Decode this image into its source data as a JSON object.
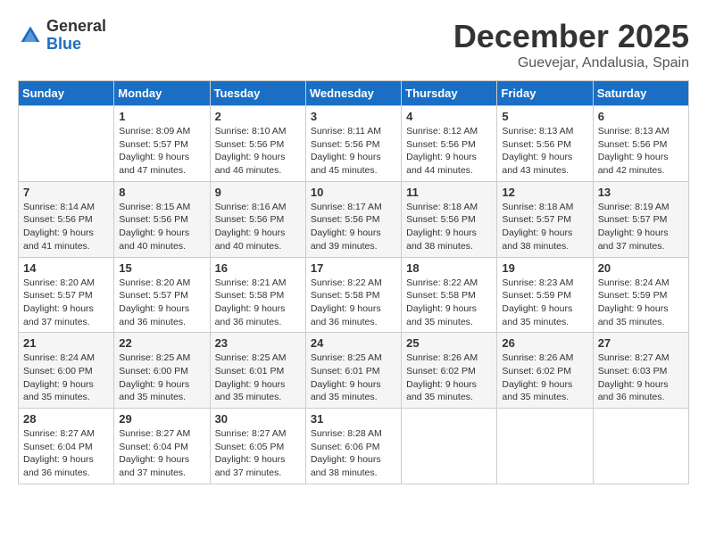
{
  "logo": {
    "general": "General",
    "blue": "Blue"
  },
  "header": {
    "month": "December 2025",
    "location": "Guevejar, Andalusia, Spain"
  },
  "columns": [
    "Sunday",
    "Monday",
    "Tuesday",
    "Wednesday",
    "Thursday",
    "Friday",
    "Saturday"
  ],
  "weeks": [
    [
      {
        "day": "",
        "empty": true
      },
      {
        "day": "1",
        "sunrise": "Sunrise: 8:09 AM",
        "sunset": "Sunset: 5:57 PM",
        "daylight": "Daylight: 9 hours and 47 minutes."
      },
      {
        "day": "2",
        "sunrise": "Sunrise: 8:10 AM",
        "sunset": "Sunset: 5:56 PM",
        "daylight": "Daylight: 9 hours and 46 minutes."
      },
      {
        "day": "3",
        "sunrise": "Sunrise: 8:11 AM",
        "sunset": "Sunset: 5:56 PM",
        "daylight": "Daylight: 9 hours and 45 minutes."
      },
      {
        "day": "4",
        "sunrise": "Sunrise: 8:12 AM",
        "sunset": "Sunset: 5:56 PM",
        "daylight": "Daylight: 9 hours and 44 minutes."
      },
      {
        "day": "5",
        "sunrise": "Sunrise: 8:13 AM",
        "sunset": "Sunset: 5:56 PM",
        "daylight": "Daylight: 9 hours and 43 minutes."
      },
      {
        "day": "6",
        "sunrise": "Sunrise: 8:13 AM",
        "sunset": "Sunset: 5:56 PM",
        "daylight": "Daylight: 9 hours and 42 minutes."
      }
    ],
    [
      {
        "day": "7",
        "sunrise": "Sunrise: 8:14 AM",
        "sunset": "Sunset: 5:56 PM",
        "daylight": "Daylight: 9 hours and 41 minutes."
      },
      {
        "day": "8",
        "sunrise": "Sunrise: 8:15 AM",
        "sunset": "Sunset: 5:56 PM",
        "daylight": "Daylight: 9 hours and 40 minutes."
      },
      {
        "day": "9",
        "sunrise": "Sunrise: 8:16 AM",
        "sunset": "Sunset: 5:56 PM",
        "daylight": "Daylight: 9 hours and 40 minutes."
      },
      {
        "day": "10",
        "sunrise": "Sunrise: 8:17 AM",
        "sunset": "Sunset: 5:56 PM",
        "daylight": "Daylight: 9 hours and 39 minutes."
      },
      {
        "day": "11",
        "sunrise": "Sunrise: 8:18 AM",
        "sunset": "Sunset: 5:56 PM",
        "daylight": "Daylight: 9 hours and 38 minutes."
      },
      {
        "day": "12",
        "sunrise": "Sunrise: 8:18 AM",
        "sunset": "Sunset: 5:57 PM",
        "daylight": "Daylight: 9 hours and 38 minutes."
      },
      {
        "day": "13",
        "sunrise": "Sunrise: 8:19 AM",
        "sunset": "Sunset: 5:57 PM",
        "daylight": "Daylight: 9 hours and 37 minutes."
      }
    ],
    [
      {
        "day": "14",
        "sunrise": "Sunrise: 8:20 AM",
        "sunset": "Sunset: 5:57 PM",
        "daylight": "Daylight: 9 hours and 37 minutes."
      },
      {
        "day": "15",
        "sunrise": "Sunrise: 8:20 AM",
        "sunset": "Sunset: 5:57 PM",
        "daylight": "Daylight: 9 hours and 36 minutes."
      },
      {
        "day": "16",
        "sunrise": "Sunrise: 8:21 AM",
        "sunset": "Sunset: 5:58 PM",
        "daylight": "Daylight: 9 hours and 36 minutes."
      },
      {
        "day": "17",
        "sunrise": "Sunrise: 8:22 AM",
        "sunset": "Sunset: 5:58 PM",
        "daylight": "Daylight: 9 hours and 36 minutes."
      },
      {
        "day": "18",
        "sunrise": "Sunrise: 8:22 AM",
        "sunset": "Sunset: 5:58 PM",
        "daylight": "Daylight: 9 hours and 35 minutes."
      },
      {
        "day": "19",
        "sunrise": "Sunrise: 8:23 AM",
        "sunset": "Sunset: 5:59 PM",
        "daylight": "Daylight: 9 hours and 35 minutes."
      },
      {
        "day": "20",
        "sunrise": "Sunrise: 8:24 AM",
        "sunset": "Sunset: 5:59 PM",
        "daylight": "Daylight: 9 hours and 35 minutes."
      }
    ],
    [
      {
        "day": "21",
        "sunrise": "Sunrise: 8:24 AM",
        "sunset": "Sunset: 6:00 PM",
        "daylight": "Daylight: 9 hours and 35 minutes."
      },
      {
        "day": "22",
        "sunrise": "Sunrise: 8:25 AM",
        "sunset": "Sunset: 6:00 PM",
        "daylight": "Daylight: 9 hours and 35 minutes."
      },
      {
        "day": "23",
        "sunrise": "Sunrise: 8:25 AM",
        "sunset": "Sunset: 6:01 PM",
        "daylight": "Daylight: 9 hours and 35 minutes."
      },
      {
        "day": "24",
        "sunrise": "Sunrise: 8:25 AM",
        "sunset": "Sunset: 6:01 PM",
        "daylight": "Daylight: 9 hours and 35 minutes."
      },
      {
        "day": "25",
        "sunrise": "Sunrise: 8:26 AM",
        "sunset": "Sunset: 6:02 PM",
        "daylight": "Daylight: 9 hours and 35 minutes."
      },
      {
        "day": "26",
        "sunrise": "Sunrise: 8:26 AM",
        "sunset": "Sunset: 6:02 PM",
        "daylight": "Daylight: 9 hours and 35 minutes."
      },
      {
        "day": "27",
        "sunrise": "Sunrise: 8:27 AM",
        "sunset": "Sunset: 6:03 PM",
        "daylight": "Daylight: 9 hours and 36 minutes."
      }
    ],
    [
      {
        "day": "28",
        "sunrise": "Sunrise: 8:27 AM",
        "sunset": "Sunset: 6:04 PM",
        "daylight": "Daylight: 9 hours and 36 minutes."
      },
      {
        "day": "29",
        "sunrise": "Sunrise: 8:27 AM",
        "sunset": "Sunset: 6:04 PM",
        "daylight": "Daylight: 9 hours and 37 minutes."
      },
      {
        "day": "30",
        "sunrise": "Sunrise: 8:27 AM",
        "sunset": "Sunset: 6:05 PM",
        "daylight": "Daylight: 9 hours and 37 minutes."
      },
      {
        "day": "31",
        "sunrise": "Sunrise: 8:28 AM",
        "sunset": "Sunset: 6:06 PM",
        "daylight": "Daylight: 9 hours and 38 minutes."
      },
      {
        "day": "",
        "empty": true
      },
      {
        "day": "",
        "empty": true
      },
      {
        "day": "",
        "empty": true
      }
    ]
  ]
}
